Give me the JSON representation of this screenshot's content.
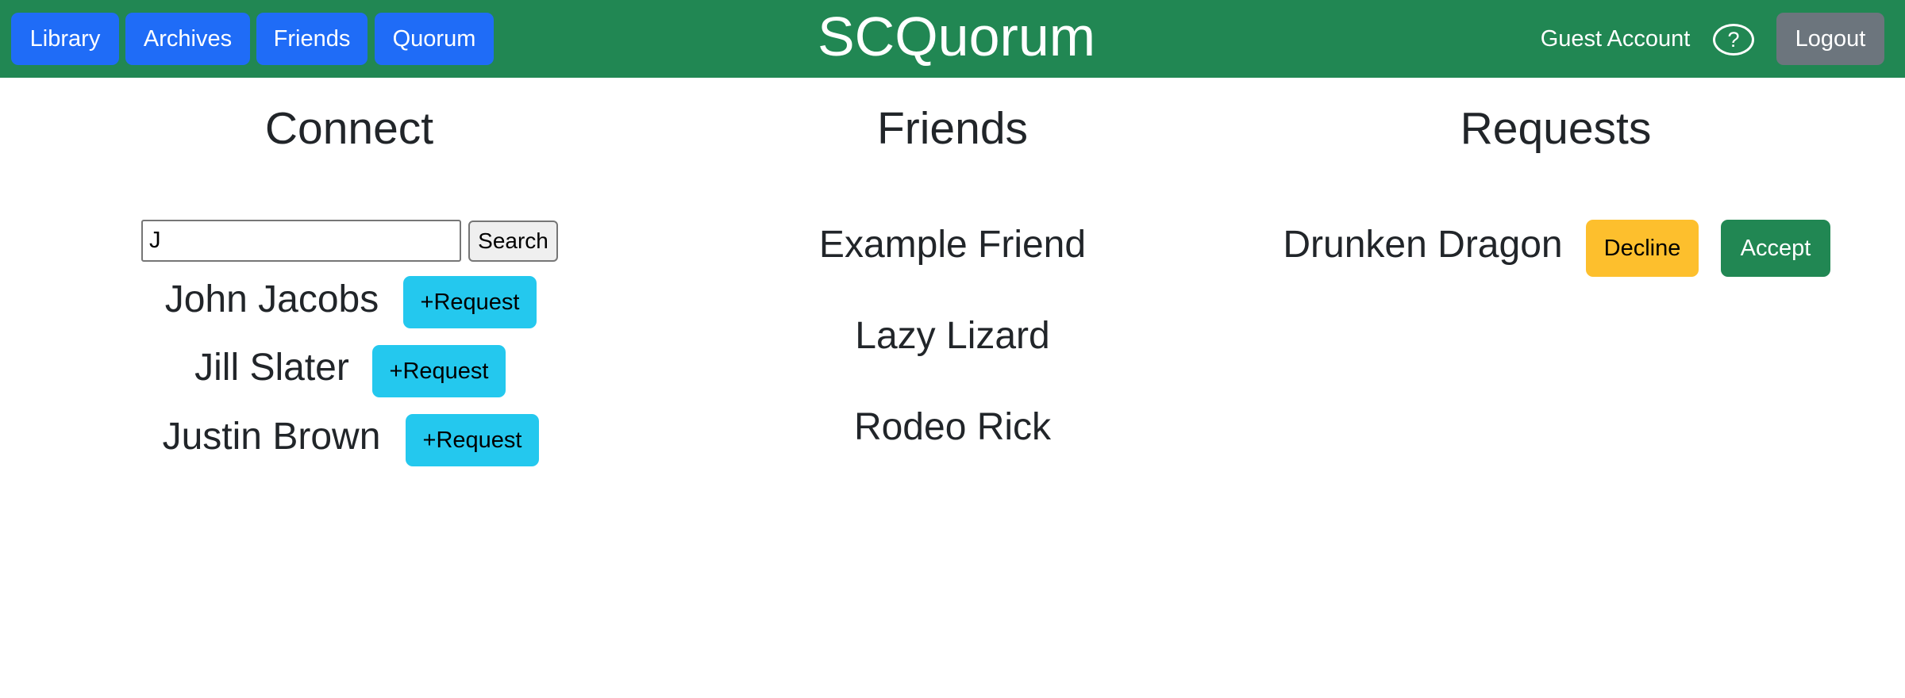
{
  "navbar": {
    "links": [
      {
        "label": "Library"
      },
      {
        "label": "Archives"
      },
      {
        "label": "Friends"
      },
      {
        "label": "Quorum"
      }
    ],
    "brand": "SCQuorum",
    "account_label": "Guest Account",
    "help_icon": "?",
    "logout_label": "Logout"
  },
  "connect": {
    "title": "Connect",
    "search_value": "J",
    "search_button": "Search",
    "results": [
      {
        "name": "John Jacobs",
        "action": "+Request"
      },
      {
        "name": "Jill Slater",
        "action": "+Request"
      },
      {
        "name": "Justin Brown",
        "action": "+Request"
      }
    ]
  },
  "friends": {
    "title": "Friends",
    "items": [
      {
        "name": "Example Friend"
      },
      {
        "name": "Lazy Lizard"
      },
      {
        "name": "Rodeo Rick"
      }
    ]
  },
  "requests": {
    "title": "Requests",
    "items": [
      {
        "name": "Drunken Dragon",
        "decline_label": "Decline",
        "accept_label": "Accept"
      }
    ]
  },
  "colors": {
    "navbar_bg": "#218753",
    "nav_button": "#1f6cf7",
    "logout_button": "#6c757d",
    "request_button": "#24c8ee",
    "decline_button": "#fdbf2d",
    "accept_button": "#218753"
  }
}
